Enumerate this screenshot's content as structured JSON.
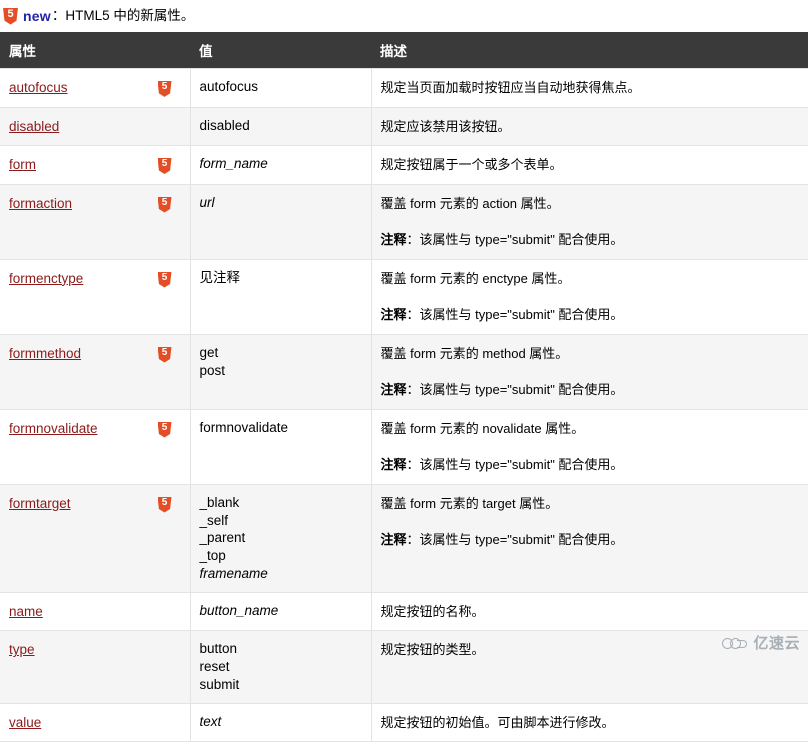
{
  "note": {
    "badge_icon": "html5-badge-icon",
    "badge_text": "5",
    "new_label": "new",
    "text": "：HTML5 中的新属性。"
  },
  "table": {
    "columns": [
      "属性",
      "值",
      "描述"
    ],
    "note_label": "注释",
    "rows": [
      {
        "attribute": "autofocus",
        "html5": true,
        "value_lines": [
          {
            "text": "autofocus",
            "italic": false
          }
        ],
        "descriptions": [
          {
            "note": false,
            "text": "规定当页面加载时按钮应当自动地获得焦点。"
          }
        ]
      },
      {
        "attribute": "disabled",
        "html5": false,
        "value_lines": [
          {
            "text": "disabled",
            "italic": false
          }
        ],
        "descriptions": [
          {
            "note": false,
            "text": "规定应该禁用该按钮。"
          }
        ]
      },
      {
        "attribute": "form",
        "html5": true,
        "value_lines": [
          {
            "text": "form_name",
            "italic": true
          }
        ],
        "descriptions": [
          {
            "note": false,
            "text": "规定按钮属于一个或多个表单。"
          }
        ]
      },
      {
        "attribute": "formaction",
        "html5": true,
        "value_lines": [
          {
            "text": "url",
            "italic": true
          }
        ],
        "descriptions": [
          {
            "note": false,
            "text": "覆盖 form 元素的 action 属性。"
          },
          {
            "note": true,
            "text": "：该属性与 type=\"submit\" 配合使用。"
          }
        ]
      },
      {
        "attribute": "formenctype",
        "html5": true,
        "value_lines": [
          {
            "text": "见注释",
            "italic": false
          }
        ],
        "descriptions": [
          {
            "note": false,
            "text": "覆盖 form 元素的 enctype 属性。"
          },
          {
            "note": true,
            "text": "：该属性与 type=\"submit\" 配合使用。"
          }
        ]
      },
      {
        "attribute": "formmethod",
        "html5": true,
        "value_lines": [
          {
            "text": "get",
            "italic": false
          },
          {
            "text": "post",
            "italic": false
          }
        ],
        "descriptions": [
          {
            "note": false,
            "text": "覆盖 form 元素的 method 属性。"
          },
          {
            "note": true,
            "text": "：该属性与 type=\"submit\" 配合使用。"
          }
        ]
      },
      {
        "attribute": "formnovalidate",
        "html5": true,
        "value_lines": [
          {
            "text": "formnovalidate",
            "italic": false
          }
        ],
        "descriptions": [
          {
            "note": false,
            "text": "覆盖 form 元素的 novalidate 属性。"
          },
          {
            "note": true,
            "text": "：该属性与 type=\"submit\" 配合使用。"
          }
        ]
      },
      {
        "attribute": "formtarget",
        "html5": true,
        "value_lines": [
          {
            "text": "_blank",
            "italic": false
          },
          {
            "text": "_self",
            "italic": false
          },
          {
            "text": "_parent",
            "italic": false
          },
          {
            "text": "_top",
            "italic": false
          },
          {
            "text": "framename",
            "italic": true
          }
        ],
        "descriptions": [
          {
            "note": false,
            "text": "覆盖 form 元素的 target 属性。"
          },
          {
            "note": true,
            "text": "：该属性与 type=\"submit\" 配合使用。"
          }
        ]
      },
      {
        "attribute": "name",
        "html5": false,
        "value_lines": [
          {
            "text": "button_name",
            "italic": true
          }
        ],
        "descriptions": [
          {
            "note": false,
            "text": "规定按钮的名称。"
          }
        ]
      },
      {
        "attribute": "type",
        "html5": false,
        "value_lines": [
          {
            "text": "button",
            "italic": false
          },
          {
            "text": "reset",
            "italic": false
          },
          {
            "text": "submit",
            "italic": false
          }
        ],
        "descriptions": [
          {
            "note": false,
            "text": "规定按钮的类型。"
          }
        ]
      },
      {
        "attribute": "value",
        "html5": false,
        "value_lines": [
          {
            "text": "text",
            "italic": true
          }
        ],
        "descriptions": [
          {
            "note": false,
            "text": "规定按钮的初始值。可由脚本进行修改。"
          }
        ]
      }
    ]
  },
  "watermark": {
    "text": "亿速云",
    "icon": "cloud-logo-icon"
  },
  "colors": {
    "header_bg": "#3a3a3a",
    "link": "#8b1a1a",
    "html5_orange": "#e34e26",
    "stripe": "#f5f5f5",
    "new_blue": "#2222aa"
  }
}
